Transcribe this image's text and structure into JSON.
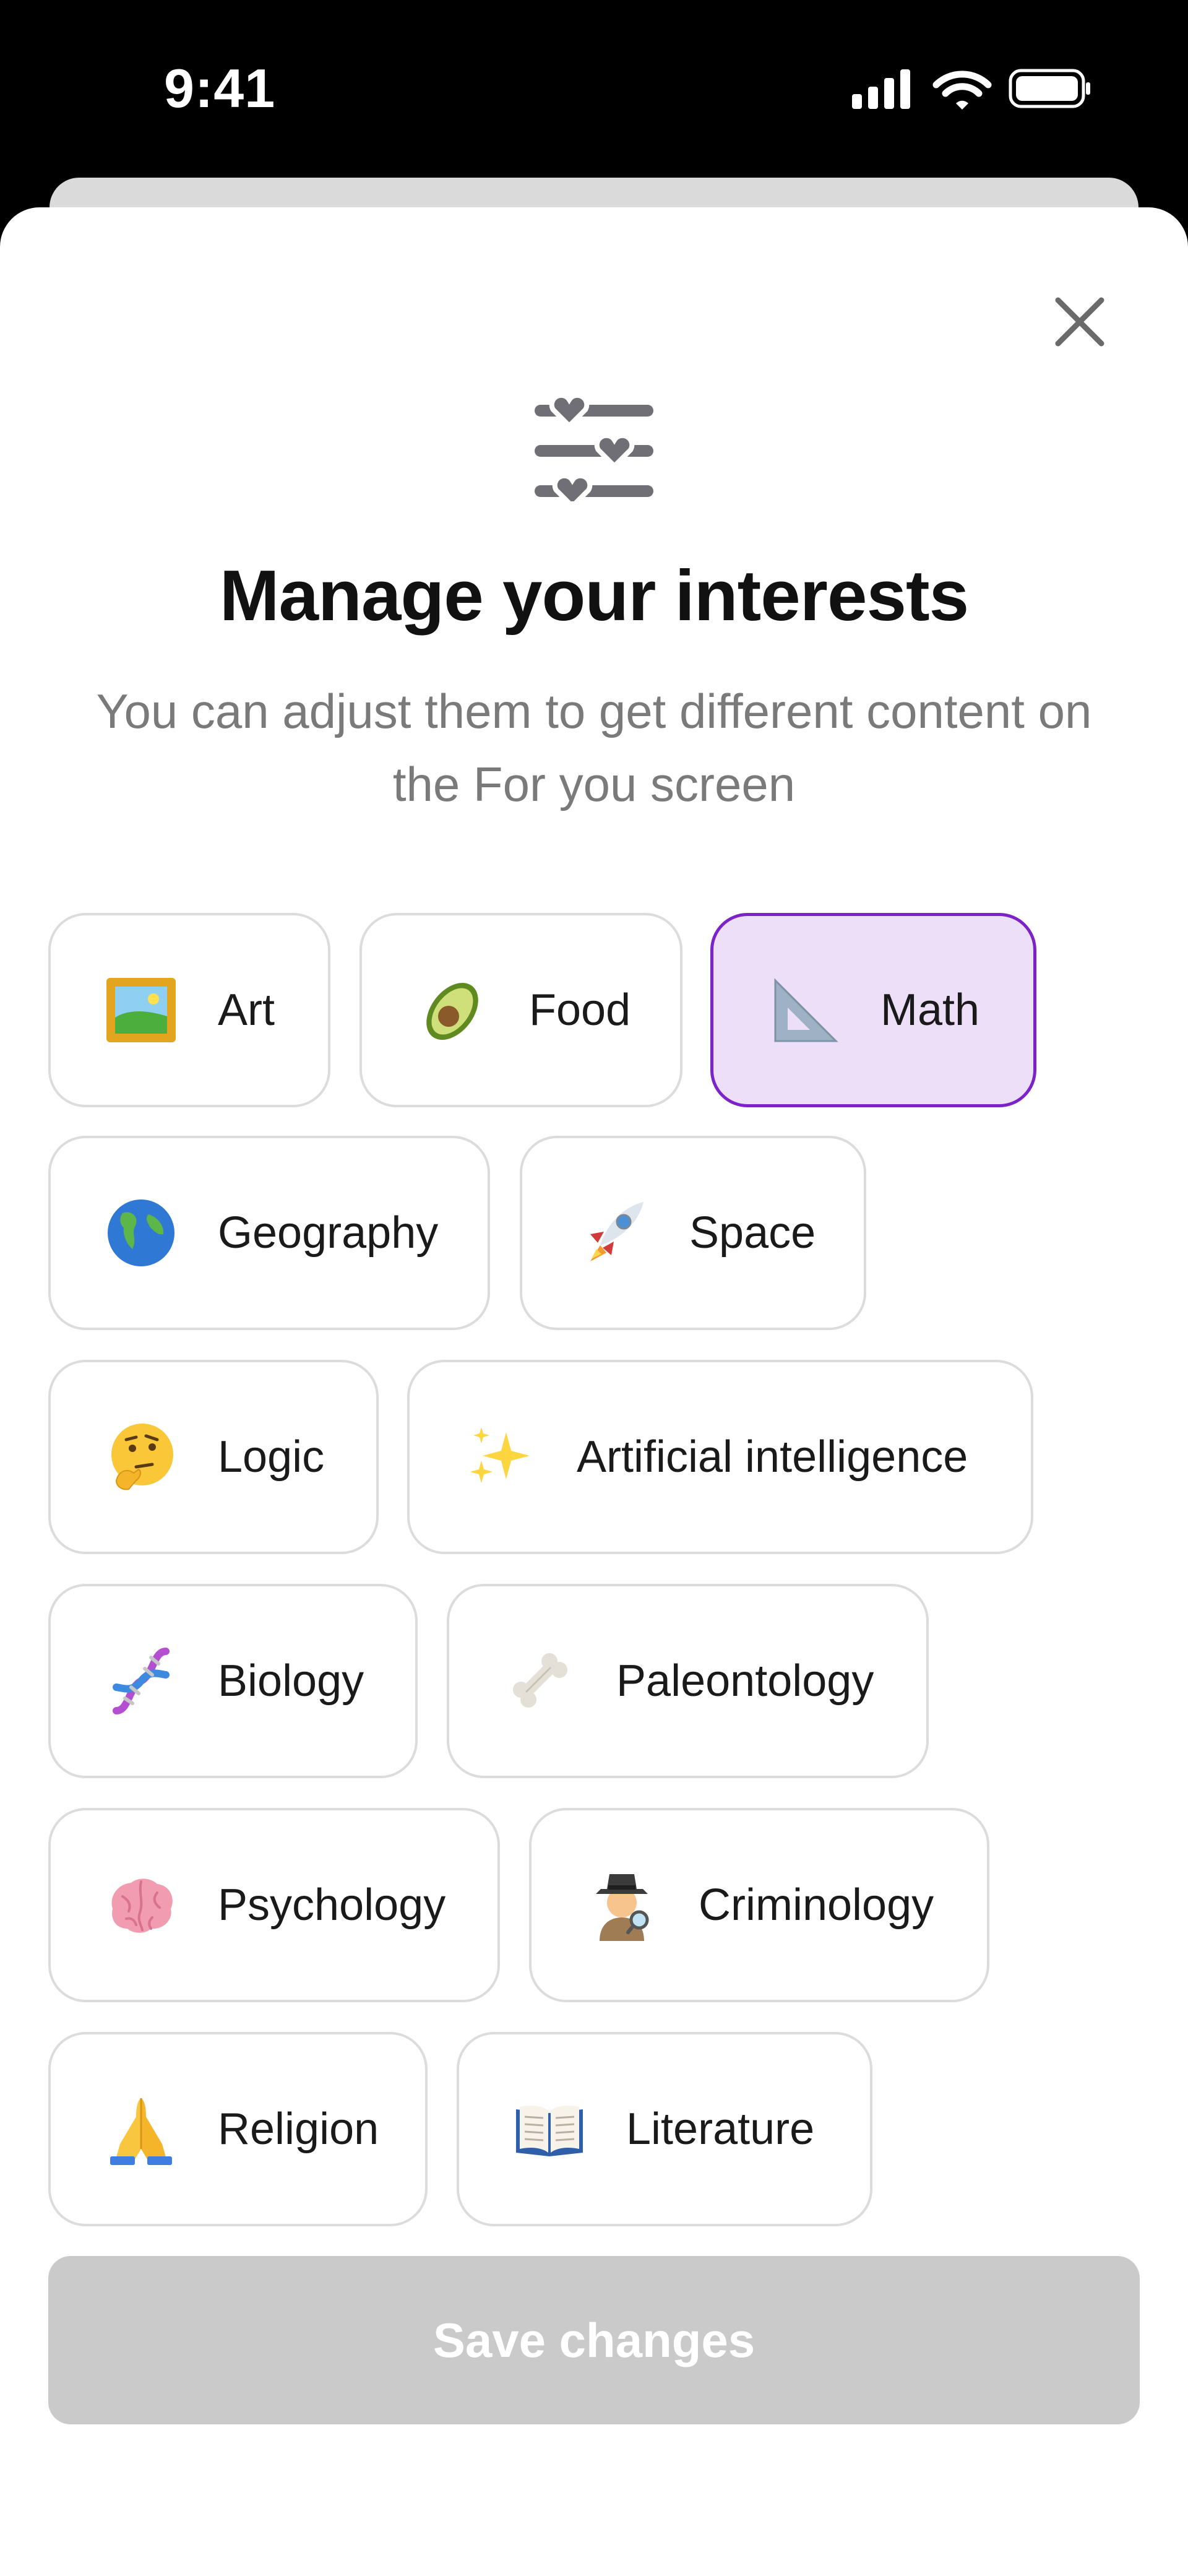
{
  "status_bar": {
    "time": "9:41"
  },
  "sheet": {
    "title": "Manage your interests",
    "subtitle": "You can adjust them to get different content on the For you screen"
  },
  "interests": [
    {
      "label": "Art",
      "icon": "framed-picture-icon",
      "selected": false
    },
    {
      "label": "Food",
      "icon": "avocado-icon",
      "selected": false
    },
    {
      "label": "Math",
      "icon": "triangular-ruler-icon",
      "selected": true
    },
    {
      "label": "Geography",
      "icon": "globe-icon",
      "selected": false
    },
    {
      "label": "Space",
      "icon": "rocket-icon",
      "selected": false
    },
    {
      "label": "Logic",
      "icon": "thinking-face-icon",
      "selected": false
    },
    {
      "label": "Artificial intelligence",
      "icon": "sparkles-icon",
      "selected": false
    },
    {
      "label": "Biology",
      "icon": "dna-icon",
      "selected": false
    },
    {
      "label": "Paleontology",
      "icon": "bone-icon",
      "selected": false
    },
    {
      "label": "Psychology",
      "icon": "brain-icon",
      "selected": false
    },
    {
      "label": "Criminology",
      "icon": "detective-icon",
      "selected": false
    },
    {
      "label": "Religion",
      "icon": "folded-hands-icon",
      "selected": false
    },
    {
      "label": "Literature",
      "icon": "open-book-icon",
      "selected": false
    }
  ],
  "save_button": {
    "label": "Save changes",
    "enabled": false
  },
  "colors": {
    "selected_bg": "#ecdff7",
    "selected_border": "#7b22c9",
    "disabled_button": "#cacaca"
  }
}
